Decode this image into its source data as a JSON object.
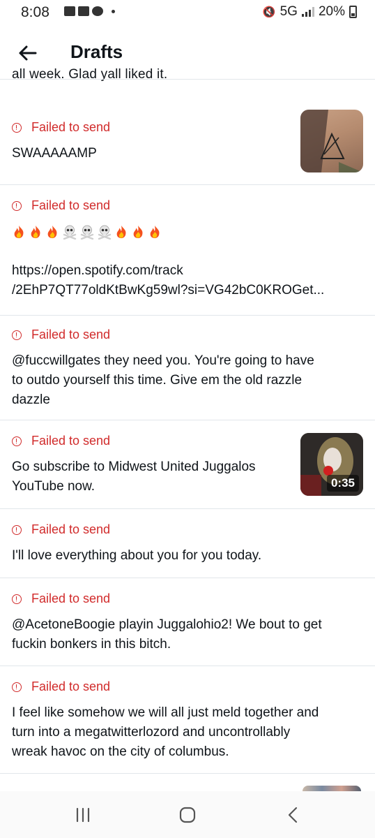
{
  "status_bar": {
    "time": "8:08",
    "network": "5G",
    "battery": "20%",
    "left_icons": [
      "mail-icon",
      "youtube-icon",
      "messenger-icon"
    ],
    "right_icons": [
      "mute-icon",
      "signal-icon",
      "battery-icon"
    ]
  },
  "header": {
    "title": "Drafts"
  },
  "partial_top_text": "all week. Glad yall liked it.",
  "drafts": [
    {
      "status": "Failed to send",
      "text": "SWAAAAAMP",
      "has_image": true
    },
    {
      "status": "Failed to send",
      "emoji_sequence": [
        "fire",
        "fire",
        "fire",
        "skull-crossbones",
        "skull-crossbones",
        "skull-crossbones",
        "fire",
        "fire",
        "fire"
      ],
      "link_line1": "https://open.spotify.com/track",
      "link_line2": "/2EhP7QT77oldKtBwKg59wl?si=VG42bC0KROGet..."
    },
    {
      "status": "Failed to send",
      "line1": "@fuccwillgates they need you. You're going to have",
      "line2": "to outdo yourself this time. Give em the old razzle",
      "line3": "dazzle"
    },
    {
      "status": "Failed to send",
      "line1": "Go subscribe to Midwest United Juggalos",
      "line2": "YouTube now.",
      "video_duration": "0:35"
    },
    {
      "status": "Failed to send",
      "line1": "I'll love everything about you for you today."
    },
    {
      "status": "Failed to send",
      "line1": "@AcetoneBoogie playin Juggalohio2! We bout to get",
      "line2": "fuckin bonkers in this bitch."
    },
    {
      "status": "Failed to send",
      "line1": "I feel like somehow we will all just meld together and",
      "line2": "turn into a megatwitterlozord and uncontrollably",
      "line3": "wreak havoc on the city of columbus."
    }
  ],
  "colors": {
    "error_red": "#d12b2b",
    "text": "#0f1419",
    "divider": "#e1e6ea"
  },
  "nav_bar": {
    "buttons": [
      "recents-icon",
      "home-icon",
      "back-icon"
    ]
  }
}
